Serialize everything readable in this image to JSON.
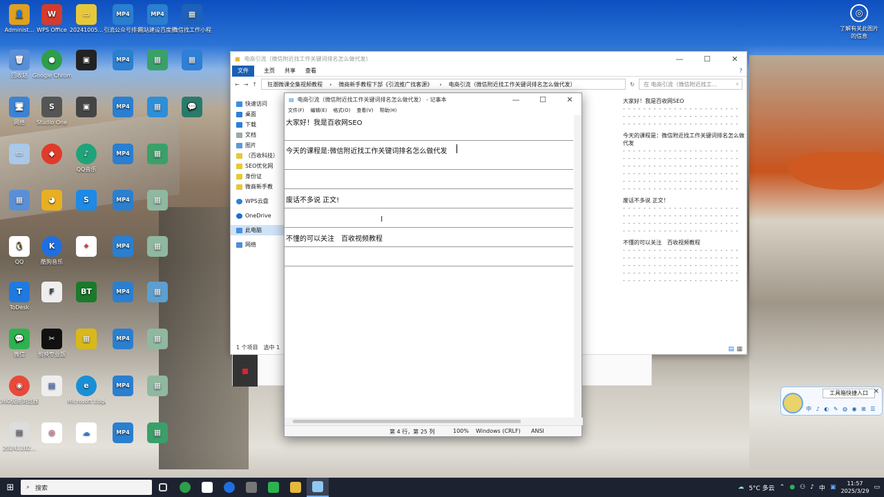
{
  "desktop": {
    "icons": [
      {
        "label": "Administ...",
        "color": "#e0a020",
        "glyph": "👤"
      },
      {
        "label": "WPS Office",
        "color": "#d33b2c",
        "glyph": "W"
      },
      {
        "label": "20241005...",
        "color": "#e7c83a",
        "glyph": "▭"
      },
      {
        "label": "引流公众号排名代发有哪...",
        "color": "#2a7fd0",
        "glyph": "MP4"
      },
      {
        "label": "网站建设百度排名代发...",
        "color": "#2a7fd0",
        "glyph": "MP4"
      },
      {
        "label": "微信找工作小程序 (9)",
        "color": "#1d62b8",
        "glyph": "▦"
      },
      {
        "label": "回收站",
        "color": "#5a8fd8",
        "glyph": "🗑"
      },
      {
        "label": "Google Chrome",
        "color": "#2e9e4a",
        "glyph": "●"
      },
      {
        "label": "QQ音乐",
        "color": "#1fa37a",
        "glyph": "♪"
      },
      {
        "label": "网络",
        "color": "#3c83d4",
        "glyph": "🖥"
      },
      {
        "label": "Studio One",
        "color": "#555555",
        "glyph": "S"
      },
      {
        "label": "ToDesk",
        "color": "#1f7ae0",
        "glyph": "T"
      },
      {
        "label": "QQ",
        "color": "#1a1a1a",
        "glyph": "🐧"
      },
      {
        "label": "酷狗音乐",
        "color": "#1f6fe0",
        "glyph": "K"
      },
      {
        "label": "微信",
        "color": "#2db24f",
        "glyph": "💬"
      },
      {
        "label": "剪映专业版",
        "color": "#111111",
        "glyph": "✂"
      },
      {
        "label": "360极速浏览器X",
        "color": "#e8493b",
        "glyph": "◉"
      },
      {
        "label": "Microsoft Edge",
        "color": "#1a8fd6",
        "glyph": "e"
      },
      {
        "label": "20241102...",
        "color": "#dddddd",
        "glyph": "▤"
      }
    ]
  },
  "info_icon": {
    "label": "了解有关此图片的信息"
  },
  "explorer": {
    "title": "电商引流（微信附近找工作关键词排名怎么做代发）",
    "ribbon_tabs": [
      "文件",
      "主页",
      "共享",
      "查看"
    ],
    "breadcrumb": [
      "狂潮微课全集视频教程",
      "微商新手教程下部《引流推广找客源》",
      "电商引流（微信附近找工作关键词排名怎么做代发）"
    ],
    "search_placeholder": "在 电商引流（微信附近找工...",
    "nav": [
      "快速访问",
      "桌面",
      "下载",
      "文档",
      "图片",
      "（百收科技）",
      "SEO优化网",
      "身份证",
      "微商新手教",
      "WPS云盘",
      "OneDrive",
      "此电脑",
      "网络"
    ],
    "status": "1 个项目　选中 1",
    "preview_lines": [
      "大家好！我是百收网SEO",
      "今天的课程是：微信附近找工作关键词排名怎么做代发",
      "废话不多说 正文！",
      "不懂的可以关注　百收视频教程"
    ],
    "dash": "- - - - - - - - - - - - - - - - - - - - - - -"
  },
  "notepad": {
    "title": "电商引流（微信附近找工作关键词排名怎么做代发） - 记事本",
    "menu": [
      "文件(F)",
      "编辑(E)",
      "格式(O)",
      "查看(V)",
      "帮助(H)"
    ],
    "lines": [
      "大家好！我是百收网SEO",
      "今天的课程是:微信附近找工作关键词排名怎么做代发",
      "废话不多说 正文!",
      "不懂的可以关注　百收视频教程"
    ],
    "status": {
      "position": "第 4 行，第 25 列",
      "zoom": "100%",
      "eol": "Windows (CRLF)",
      "encoding": "ANSI"
    }
  },
  "widget": {
    "title": "工具箱快捷入口",
    "ime": "中 ♪ ◐ ✎ ◍ ◉ ⊞ ☰"
  },
  "taskbar": {
    "search_placeholder": "搜索",
    "weather": "5°C 多云",
    "ime": "中",
    "time": "11:57",
    "date": "2025/3/29"
  }
}
